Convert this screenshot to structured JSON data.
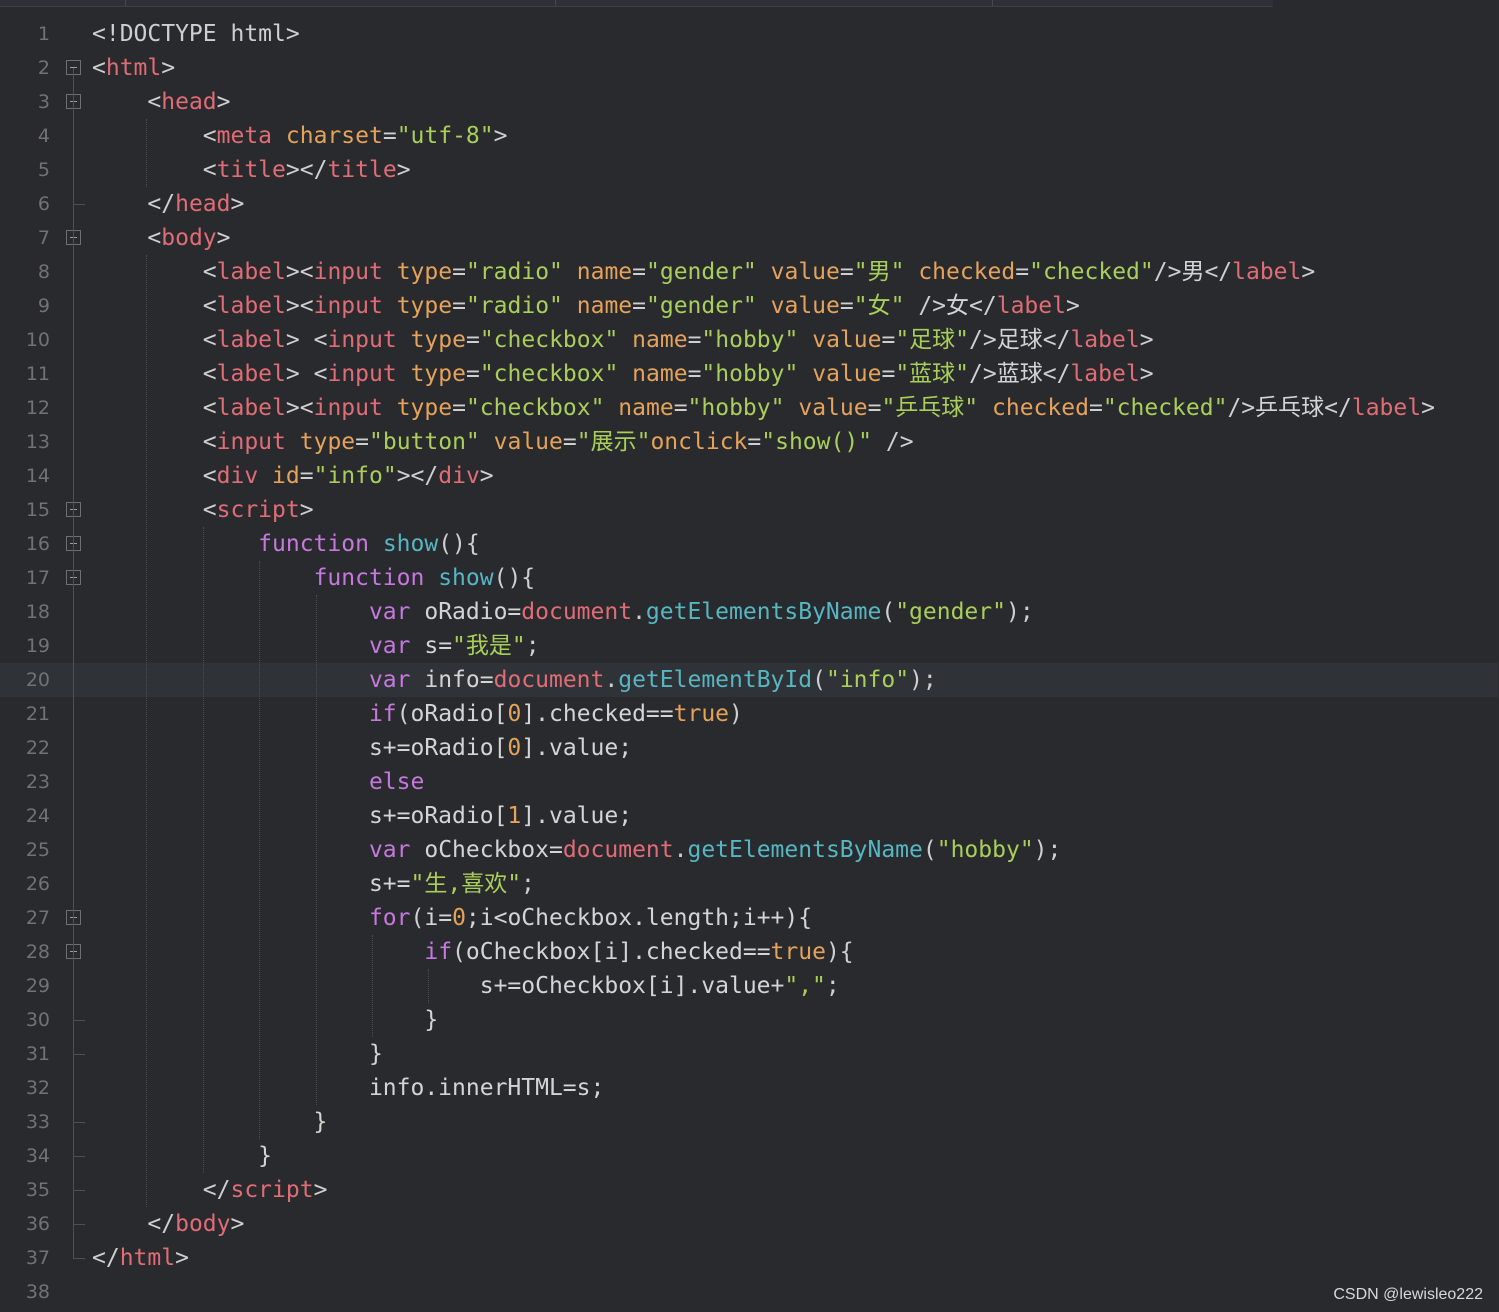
{
  "editor": {
    "language": "html",
    "current_line": 20,
    "line_numbers": [
      "1",
      "2",
      "3",
      "4",
      "5",
      "6",
      "7",
      "8",
      "9",
      "10",
      "11",
      "12",
      "13",
      "14",
      "15",
      "16",
      "17",
      "18",
      "19",
      "20",
      "21",
      "22",
      "23",
      "24",
      "25",
      "26",
      "27",
      "28",
      "29",
      "30",
      "31",
      "32",
      "33",
      "34",
      "35",
      "36",
      "37",
      "38"
    ],
    "lines": [
      [
        [
          "t-punct",
          "<!DOCTYPE html>"
        ]
      ],
      [
        [
          "t-punct",
          "<"
        ],
        [
          "t-tag",
          "html"
        ],
        [
          "t-punct",
          ">"
        ]
      ],
      [
        [
          "t-txt",
          "    "
        ],
        [
          "t-punct",
          "<"
        ],
        [
          "t-tag",
          "head"
        ],
        [
          "t-punct",
          ">"
        ]
      ],
      [
        [
          "t-txt",
          "        "
        ],
        [
          "t-punct",
          "<"
        ],
        [
          "t-tag",
          "meta"
        ],
        [
          "t-txt",
          " "
        ],
        [
          "t-attr",
          "charset"
        ],
        [
          "t-punct",
          "="
        ],
        [
          "t-str",
          "\"utf-8\""
        ],
        [
          "t-punct",
          ">"
        ]
      ],
      [
        [
          "t-txt",
          "        "
        ],
        [
          "t-punct",
          "<"
        ],
        [
          "t-tag",
          "title"
        ],
        [
          "t-punct",
          "></"
        ],
        [
          "t-tag",
          "title"
        ],
        [
          "t-punct",
          ">"
        ]
      ],
      [
        [
          "t-txt",
          "    "
        ],
        [
          "t-punct",
          "</"
        ],
        [
          "t-tag",
          "head"
        ],
        [
          "t-punct",
          ">"
        ]
      ],
      [
        [
          "t-txt",
          "    "
        ],
        [
          "t-punct",
          "<"
        ],
        [
          "t-tag",
          "body"
        ],
        [
          "t-punct",
          ">"
        ]
      ],
      [
        [
          "t-txt",
          "        "
        ],
        [
          "t-punct",
          "<"
        ],
        [
          "t-tag",
          "label"
        ],
        [
          "t-punct",
          "><"
        ],
        [
          "t-tag",
          "input"
        ],
        [
          "t-txt",
          " "
        ],
        [
          "t-attr",
          "type"
        ],
        [
          "t-punct",
          "="
        ],
        [
          "t-str",
          "\"radio\""
        ],
        [
          "t-txt",
          " "
        ],
        [
          "t-attr",
          "name"
        ],
        [
          "t-punct",
          "="
        ],
        [
          "t-str",
          "\"gender\""
        ],
        [
          "t-txt",
          " "
        ],
        [
          "t-attr",
          "value"
        ],
        [
          "t-punct",
          "="
        ],
        [
          "t-str",
          "\"男\""
        ],
        [
          "t-txt",
          " "
        ],
        [
          "t-attr",
          "checked"
        ],
        [
          "t-punct",
          "="
        ],
        [
          "t-str",
          "\"checked\""
        ],
        [
          "t-punct",
          "/>"
        ],
        [
          "t-txt",
          "男"
        ],
        [
          "t-punct",
          "</"
        ],
        [
          "t-tag",
          "label"
        ],
        [
          "t-punct",
          ">"
        ]
      ],
      [
        [
          "t-txt",
          "        "
        ],
        [
          "t-punct",
          "<"
        ],
        [
          "t-tag",
          "label"
        ],
        [
          "t-punct",
          "><"
        ],
        [
          "t-tag",
          "input"
        ],
        [
          "t-txt",
          " "
        ],
        [
          "t-attr",
          "type"
        ],
        [
          "t-punct",
          "="
        ],
        [
          "t-str",
          "\"radio\""
        ],
        [
          "t-txt",
          " "
        ],
        [
          "t-attr",
          "name"
        ],
        [
          "t-punct",
          "="
        ],
        [
          "t-str",
          "\"gender\""
        ],
        [
          "t-txt",
          " "
        ],
        [
          "t-attr",
          "value"
        ],
        [
          "t-punct",
          "="
        ],
        [
          "t-str",
          "\"女\""
        ],
        [
          "t-txt",
          " "
        ],
        [
          "t-punct",
          "/>"
        ],
        [
          "t-txt",
          "女"
        ],
        [
          "t-punct",
          "</"
        ],
        [
          "t-tag",
          "label"
        ],
        [
          "t-punct",
          ">"
        ]
      ],
      [
        [
          "t-txt",
          "        "
        ],
        [
          "t-punct",
          "<"
        ],
        [
          "t-tag",
          "label"
        ],
        [
          "t-punct",
          ">"
        ],
        [
          "t-txt",
          " "
        ],
        [
          "t-punct",
          "<"
        ],
        [
          "t-tag",
          "input"
        ],
        [
          "t-txt",
          " "
        ],
        [
          "t-attr",
          "type"
        ],
        [
          "t-punct",
          "="
        ],
        [
          "t-str",
          "\"checkbox\""
        ],
        [
          "t-txt",
          " "
        ],
        [
          "t-attr",
          "name"
        ],
        [
          "t-punct",
          "="
        ],
        [
          "t-str",
          "\"hobby\""
        ],
        [
          "t-txt",
          " "
        ],
        [
          "t-attr",
          "value"
        ],
        [
          "t-punct",
          "="
        ],
        [
          "t-str",
          "\"足球\""
        ],
        [
          "t-punct",
          "/>"
        ],
        [
          "t-txt",
          "足球"
        ],
        [
          "t-punct",
          "</"
        ],
        [
          "t-tag",
          "label"
        ],
        [
          "t-punct",
          ">"
        ]
      ],
      [
        [
          "t-txt",
          "        "
        ],
        [
          "t-punct",
          "<"
        ],
        [
          "t-tag",
          "label"
        ],
        [
          "t-punct",
          ">"
        ],
        [
          "t-txt",
          " "
        ],
        [
          "t-punct",
          "<"
        ],
        [
          "t-tag",
          "input"
        ],
        [
          "t-txt",
          " "
        ],
        [
          "t-attr",
          "type"
        ],
        [
          "t-punct",
          "="
        ],
        [
          "t-str",
          "\"checkbox\""
        ],
        [
          "t-txt",
          " "
        ],
        [
          "t-attr",
          "name"
        ],
        [
          "t-punct",
          "="
        ],
        [
          "t-str",
          "\"hobby\""
        ],
        [
          "t-txt",
          " "
        ],
        [
          "t-attr",
          "value"
        ],
        [
          "t-punct",
          "="
        ],
        [
          "t-str",
          "\"蓝球\""
        ],
        [
          "t-punct",
          "/>"
        ],
        [
          "t-txt",
          "蓝球"
        ],
        [
          "t-punct",
          "</"
        ],
        [
          "t-tag",
          "label"
        ],
        [
          "t-punct",
          ">"
        ]
      ],
      [
        [
          "t-txt",
          "        "
        ],
        [
          "t-punct",
          "<"
        ],
        [
          "t-tag",
          "label"
        ],
        [
          "t-punct",
          "><"
        ],
        [
          "t-tag",
          "input"
        ],
        [
          "t-txt",
          " "
        ],
        [
          "t-attr",
          "type"
        ],
        [
          "t-punct",
          "="
        ],
        [
          "t-str",
          "\"checkbox\""
        ],
        [
          "t-txt",
          " "
        ],
        [
          "t-attr",
          "name"
        ],
        [
          "t-punct",
          "="
        ],
        [
          "t-str",
          "\"hobby\""
        ],
        [
          "t-txt",
          " "
        ],
        [
          "t-attr",
          "value"
        ],
        [
          "t-punct",
          "="
        ],
        [
          "t-str",
          "\"乒乓球\""
        ],
        [
          "t-txt",
          " "
        ],
        [
          "t-attr",
          "checked"
        ],
        [
          "t-punct",
          "="
        ],
        [
          "t-str",
          "\"checked\""
        ],
        [
          "t-punct",
          "/>"
        ],
        [
          "t-txt",
          "乒乓球"
        ],
        [
          "t-punct",
          "</"
        ],
        [
          "t-tag",
          "label"
        ],
        [
          "t-punct",
          ">"
        ]
      ],
      [
        [
          "t-txt",
          "        "
        ],
        [
          "t-punct",
          "<"
        ],
        [
          "t-tag",
          "input"
        ],
        [
          "t-txt",
          " "
        ],
        [
          "t-attr",
          "type"
        ],
        [
          "t-punct",
          "="
        ],
        [
          "t-str",
          "\"button\""
        ],
        [
          "t-txt",
          " "
        ],
        [
          "t-attr",
          "value"
        ],
        [
          "t-punct",
          "="
        ],
        [
          "t-str",
          "\"展示\""
        ],
        [
          "t-attr",
          "onclick"
        ],
        [
          "t-punct",
          "="
        ],
        [
          "t-str",
          "\"show()\""
        ],
        [
          "t-txt",
          " "
        ],
        [
          "t-punct",
          "/>"
        ]
      ],
      [
        [
          "t-txt",
          "        "
        ],
        [
          "t-punct",
          "<"
        ],
        [
          "t-tag",
          "div"
        ],
        [
          "t-txt",
          " "
        ],
        [
          "t-attr",
          "id"
        ],
        [
          "t-punct",
          "="
        ],
        [
          "t-str",
          "\"info\""
        ],
        [
          "t-punct",
          "></"
        ],
        [
          "t-tag",
          "div"
        ],
        [
          "t-punct",
          ">"
        ]
      ],
      [
        [
          "t-txt",
          "        "
        ],
        [
          "t-punct",
          "<"
        ],
        [
          "t-tag",
          "script"
        ],
        [
          "t-punct",
          ">"
        ]
      ],
      [
        [
          "t-txt",
          "            "
        ],
        [
          "t-kw",
          "function"
        ],
        [
          "t-txt",
          " "
        ],
        [
          "t-fn",
          "show"
        ],
        [
          "t-punct",
          "(){"
        ]
      ],
      [
        [
          "t-txt",
          "                "
        ],
        [
          "t-kw",
          "function"
        ],
        [
          "t-txt",
          " "
        ],
        [
          "t-fn",
          "show"
        ],
        [
          "t-punct",
          "(){"
        ]
      ],
      [
        [
          "t-txt",
          "                    "
        ],
        [
          "t-kw",
          "var"
        ],
        [
          "t-txt",
          " oRadio="
        ],
        [
          "t-obj",
          "document"
        ],
        [
          "t-punct",
          "."
        ],
        [
          "t-fn",
          "getElementsByName"
        ],
        [
          "t-punct",
          "("
        ],
        [
          "t-str",
          "\"gender\""
        ],
        [
          "t-punct",
          ");"
        ]
      ],
      [
        [
          "t-txt",
          "                    "
        ],
        [
          "t-kw",
          "var"
        ],
        [
          "t-txt",
          " s="
        ],
        [
          "t-str",
          "\"我是\""
        ],
        [
          "t-punct",
          ";"
        ]
      ],
      [
        [
          "t-txt",
          "                    "
        ],
        [
          "t-kw",
          "var"
        ],
        [
          "t-txt",
          " info="
        ],
        [
          "t-obj",
          "document"
        ],
        [
          "t-punct",
          "."
        ],
        [
          "t-fn",
          "getElementById"
        ],
        [
          "t-punct",
          "("
        ],
        [
          "t-str",
          "\"info\""
        ],
        [
          "t-punct",
          ");"
        ]
      ],
      [
        [
          "t-txt",
          "                    "
        ],
        [
          "t-kw",
          "if"
        ],
        [
          "t-punct",
          "("
        ],
        [
          "t-txt",
          "oRadio["
        ],
        [
          "t-num",
          "0"
        ],
        [
          "t-txt",
          "].checked=="
        ],
        [
          "t-bool",
          "true"
        ],
        [
          "t-punct",
          ")"
        ]
      ],
      [
        [
          "t-txt",
          "                    s+=oRadio["
        ],
        [
          "t-num",
          "0"
        ],
        [
          "t-txt",
          "].value;"
        ]
      ],
      [
        [
          "t-txt",
          "                    "
        ],
        [
          "t-kw",
          "else"
        ]
      ],
      [
        [
          "t-txt",
          "                    s+=oRadio["
        ],
        [
          "t-num",
          "1"
        ],
        [
          "t-txt",
          "].value;"
        ]
      ],
      [
        [
          "t-txt",
          "                    "
        ],
        [
          "t-kw",
          "var"
        ],
        [
          "t-txt",
          " oCheckbox="
        ],
        [
          "t-obj",
          "document"
        ],
        [
          "t-punct",
          "."
        ],
        [
          "t-fn",
          "getElementsByName"
        ],
        [
          "t-punct",
          "("
        ],
        [
          "t-str",
          "\"hobby\""
        ],
        [
          "t-punct",
          ");"
        ]
      ],
      [
        [
          "t-txt",
          "                    s+="
        ],
        [
          "t-str",
          "\"生,喜欢\""
        ],
        [
          "t-punct",
          ";"
        ]
      ],
      [
        [
          "t-txt",
          "                    "
        ],
        [
          "t-kw",
          "for"
        ],
        [
          "t-punct",
          "("
        ],
        [
          "t-txt",
          "i="
        ],
        [
          "t-num",
          "0"
        ],
        [
          "t-txt",
          ";i<oCheckbox.length;i++){"
        ]
      ],
      [
        [
          "t-txt",
          "                        "
        ],
        [
          "t-kw",
          "if"
        ],
        [
          "t-punct",
          "("
        ],
        [
          "t-txt",
          "oCheckbox[i].checked=="
        ],
        [
          "t-bool",
          "true"
        ],
        [
          "t-punct",
          "){"
        ]
      ],
      [
        [
          "t-txt",
          "                            s+=oCheckbox[i].value+"
        ],
        [
          "t-str",
          "\",\""
        ],
        [
          "t-punct",
          ";"
        ]
      ],
      [
        [
          "t-txt",
          "                        }"
        ]
      ],
      [
        [
          "t-txt",
          "                    }"
        ]
      ],
      [
        [
          "t-txt",
          "                    info.innerHTML=s;"
        ]
      ],
      [
        [
          "t-txt",
          "                }"
        ]
      ],
      [
        [
          "t-txt",
          "            }"
        ]
      ],
      [
        [
          "t-txt",
          "        "
        ],
        [
          "t-punct",
          "</"
        ],
        [
          "t-tag",
          "script"
        ],
        [
          "t-punct",
          ">"
        ]
      ],
      [
        [
          "t-txt",
          "    "
        ],
        [
          "t-punct",
          "</"
        ],
        [
          "t-tag",
          "body"
        ],
        [
          "t-punct",
          ">"
        ]
      ],
      [
        [
          "t-punct",
          "</"
        ],
        [
          "t-tag",
          "html"
        ],
        [
          "t-punct",
          ">"
        ]
      ],
      []
    ],
    "fold_markers": [
      2,
      3,
      7,
      15,
      16,
      17,
      27,
      28
    ],
    "fold_ends": [
      6,
      30,
      31,
      33,
      34,
      35,
      36,
      37
    ]
  },
  "watermark": "CSDN @lewisleo222"
}
